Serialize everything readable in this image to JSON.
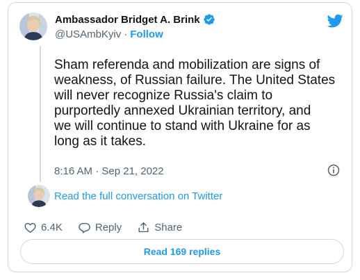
{
  "author": {
    "name": "Ambassador Bridget A. Brink",
    "handle": "@USAmbKyiv",
    "separator": "·",
    "follow_label": "Follow",
    "verified_icon": "verified-badge-icon",
    "brand_icon": "twitter-bird-icon"
  },
  "tweet": {
    "lines": [
      "Sham referenda and mobilization are signs of",
      "weakness, of Russian failure. The United States",
      "will never recognize Russia's claim to",
      "purportedly annexed Ukrainian territory, and",
      "we will continue to stand with Ukraine for as",
      "long as it takes."
    ],
    "timestamp": "8:16 AM · Sep 21, 2022"
  },
  "conversation_link": "Read the full conversation on Twitter",
  "actions": {
    "like_count": "6.4K",
    "reply_label": "Reply",
    "share_label": "Share"
  },
  "read_replies_label": "Read 169 replies",
  "colors": {
    "accent": "#1d9bf0",
    "text": "#0f1419",
    "muted": "#536471",
    "border": "#cfd9de"
  }
}
